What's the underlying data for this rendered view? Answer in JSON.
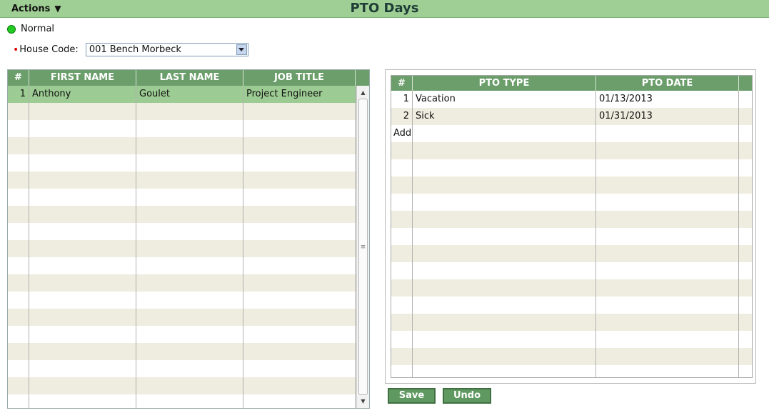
{
  "header": {
    "actions_label": "Actions",
    "actions_arrow": "▼",
    "title": "PTO Days"
  },
  "status": {
    "label": "Normal",
    "color": "#22cc22"
  },
  "house_code": {
    "required_marker": "•",
    "label": "House Code:",
    "value": "001 Bench Morbeck"
  },
  "employees": {
    "columns": [
      "#",
      "FIRST NAME",
      "LAST NAME",
      "JOB TITLE"
    ],
    "rows": [
      {
        "num": "1",
        "first": "Anthony",
        "last": "Goulet",
        "title": "Project Engineer"
      }
    ]
  },
  "pto": {
    "columns": [
      "#",
      "PTO TYPE",
      "PTO DATE"
    ],
    "rows": [
      {
        "num": "1",
        "type": "Vacation",
        "date": "01/13/2013"
      },
      {
        "num": "2",
        "type": "Sick",
        "date": "01/31/2013"
      }
    ],
    "add_label": "Add"
  },
  "buttons": {
    "save": "Save",
    "undo": "Undo"
  },
  "colors": {
    "header_bar": "#9fcf94",
    "grid_header": "#6b9e6a",
    "selected_row": "#9ccc93",
    "alt_row": "#efede0",
    "button": "#5f9860"
  }
}
